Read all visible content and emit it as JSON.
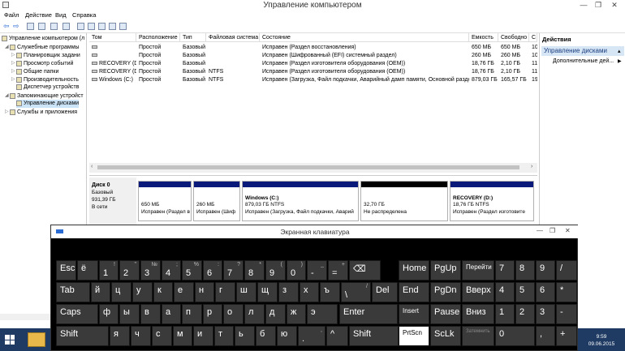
{
  "window": {
    "title": "Управление компьютером"
  },
  "menu": [
    "Файл",
    "Действие",
    "Вид",
    "Справка"
  ],
  "tree": {
    "root": "Управление компьютером (л",
    "items": [
      {
        "label": "Служебные программы",
        "level": 1
      },
      {
        "label": "Планировщик задани",
        "level": 2
      },
      {
        "label": "Просмотр событий",
        "level": 2
      },
      {
        "label": "Общие папки",
        "level": 2
      },
      {
        "label": "Производительность",
        "level": 2
      },
      {
        "label": "Диспетчер устройств",
        "level": 2
      },
      {
        "label": "Запоминающие устройст",
        "level": 1
      },
      {
        "label": "Управление дисками",
        "level": 2
      },
      {
        "label": "Службы и приложения",
        "level": 1
      }
    ]
  },
  "table": {
    "headers": [
      "Том",
      "Расположение",
      "Тип",
      "Файловая система",
      "Состояние",
      "Емкость",
      "Свободно",
      "С"
    ],
    "rows": [
      [
        "",
        "Простой",
        "Базовый",
        "",
        "Исправен (Раздел восстановления)",
        "650 МБ",
        "650 МБ",
        "10"
      ],
      [
        "",
        "Простой",
        "Базовый",
        "",
        "Исправен (Шифрованный (EFI) системный раздел)",
        "260 МБ",
        "260 МБ",
        "10"
      ],
      [
        "RECOVERY (D:)",
        "Простой",
        "Базовый",
        "",
        "Исправен (Раздел изготовителя оборудования (OEM))",
        "18,76 ГБ",
        "2,10 ГБ",
        "11"
      ],
      [
        "RECOVERY (D:)",
        "Простой",
        "Базовый",
        "NTFS",
        "Исправен (Раздел изготовителя оборудования (OEM))",
        "18,76 ГБ",
        "2,10 ГБ",
        "11"
      ],
      [
        "Windows (C:)",
        "Простой",
        "Базовый",
        "NTFS",
        "Исправен (Загрузка, Файл подкачки, Аварийный дамп памяти, Основной раздел)",
        "879,03 ГБ",
        "165,57 ГБ",
        "19"
      ]
    ]
  },
  "disk": {
    "name": "Диск 0",
    "type": "Базовый",
    "size": "931,39 ГБ",
    "status": "В сети",
    "partitions": [
      {
        "line1": "",
        "line2": "650 МБ",
        "line3": "Исправен (Раздел в"
      },
      {
        "line1": "",
        "line2": "260 МБ",
        "line3": "Исправен (Шиф"
      },
      {
        "line1": "Windows (C:)",
        "line2": "879,03 ГБ NTFS",
        "line3": "Исправен (Загрузка, Файл подкачки, Аварий"
      },
      {
        "line1": "",
        "line2": "32,70 ГБ",
        "line3": "Не распределена"
      },
      {
        "line1": "RECOVERY (D:)",
        "line2": "18,76 ГБ NTFS",
        "line3": "Исправен (Раздел изготовите"
      }
    ]
  },
  "actions": {
    "header": "Действия",
    "selected": "Управление дисками",
    "item": "Дополнительные дей..."
  },
  "osk": {
    "title": "Экранная клавиатура",
    "keys": {
      "row1": [
        {
          "m": "Esc"
        },
        {
          "m": "ё"
        },
        {
          "m": "1",
          "s": "!"
        },
        {
          "m": "2",
          "s": "\""
        },
        {
          "m": "3",
          "s": "№"
        },
        {
          "m": "4",
          "s": ";"
        },
        {
          "m": "5",
          "s": "%"
        },
        {
          "m": "6",
          "s": ":"
        },
        {
          "m": "7",
          "s": "?"
        },
        {
          "m": "8",
          "s": "*"
        },
        {
          "m": "9",
          "s": "("
        },
        {
          "m": "0",
          "s": ")"
        },
        {
          "m": "-",
          "s": "_"
        },
        {
          "m": "=",
          "s": "+"
        },
        {
          "m": "⌫"
        },
        {
          "m": "Home"
        },
        {
          "m": "PgUp"
        },
        {
          "m": "Перейти"
        },
        {
          "m": "7"
        },
        {
          "m": "8"
        },
        {
          "m": "9"
        },
        {
          "m": "/"
        }
      ],
      "row2": [
        {
          "m": "Tab"
        },
        {
          "m": "й"
        },
        {
          "m": "ц"
        },
        {
          "m": "у"
        },
        {
          "m": "к"
        },
        {
          "m": "е"
        },
        {
          "m": "н"
        },
        {
          "m": "г"
        },
        {
          "m": "ш"
        },
        {
          "m": "щ"
        },
        {
          "m": "з"
        },
        {
          "m": "х"
        },
        {
          "m": "ъ"
        },
        {
          "m": "\\",
          "s": "/"
        },
        {
          "m": "Del"
        },
        {
          "m": "End"
        },
        {
          "m": "PgDn"
        },
        {
          "m": "Вверх"
        },
        {
          "m": "4"
        },
        {
          "m": "5"
        },
        {
          "m": "6"
        },
        {
          "m": "*"
        }
      ],
      "row3": [
        {
          "m": "Caps"
        },
        {
          "m": "ф"
        },
        {
          "m": "ы"
        },
        {
          "m": "в"
        },
        {
          "m": "а"
        },
        {
          "m": "п"
        },
        {
          "m": "р"
        },
        {
          "m": "о"
        },
        {
          "m": "л"
        },
        {
          "m": "д"
        },
        {
          "m": "ж"
        },
        {
          "m": "э"
        },
        {
          "m": "Enter"
        },
        {
          "m": "Insert"
        },
        {
          "m": "Pause"
        },
        {
          "m": "Вниз"
        },
        {
          "m": "1"
        },
        {
          "m": "2"
        },
        {
          "m": "3"
        },
        {
          "m": "-"
        }
      ],
      "row4": [
        {
          "m": "Shift"
        },
        {
          "m": "я"
        },
        {
          "m": "ч"
        },
        {
          "m": "с"
        },
        {
          "m": "м"
        },
        {
          "m": "и"
        },
        {
          "m": "т"
        },
        {
          "m": "ь"
        },
        {
          "m": "б"
        },
        {
          "m": "ю"
        },
        {
          "m": ".",
          "s": ","
        },
        {
          "m": "^"
        },
        {
          "m": "Shift"
        },
        {
          "m": "PrtScn"
        },
        {
          "m": "ScLk"
        },
        {
          "m": "Затемнить"
        },
        {
          "m": "0"
        },
        {
          "m": ","
        },
        {
          "m": "+"
        }
      ]
    }
  },
  "clock": {
    "time": "9:59",
    "date": "09.06.2015"
  }
}
